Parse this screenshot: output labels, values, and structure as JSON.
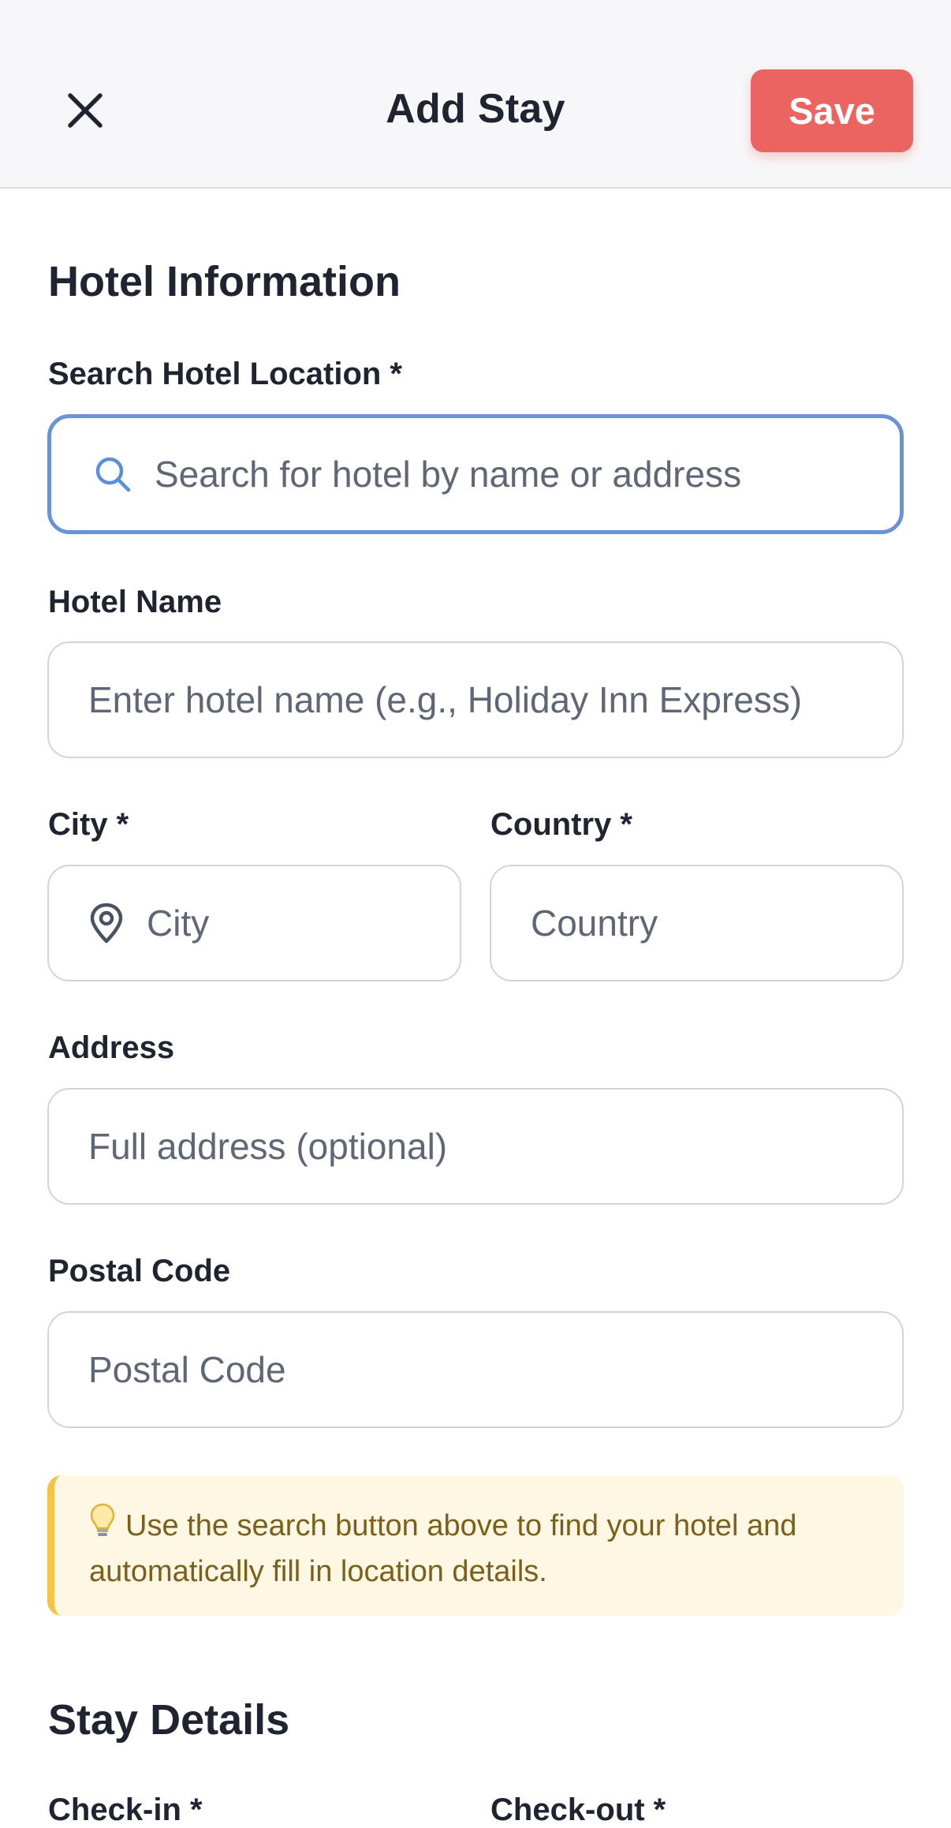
{
  "header": {
    "title": "Add Stay",
    "save_label": "Save",
    "close_icon": "close-icon"
  },
  "hotel_section": {
    "title": "Hotel Information",
    "search": {
      "label": "Search Hotel Location *",
      "placeholder": "Search for hotel by name or address",
      "value": "",
      "icon": "search-icon"
    },
    "hotel_name": {
      "label": "Hotel Name",
      "placeholder": "Enter hotel name (e.g., Holiday Inn Express)",
      "value": ""
    },
    "city": {
      "label": "City *",
      "placeholder": "City",
      "value": "",
      "icon": "location-pin-icon"
    },
    "country": {
      "label": "Country *",
      "placeholder": "Country",
      "value": ""
    },
    "address": {
      "label": "Address",
      "placeholder": "Full address (optional)",
      "value": ""
    },
    "postal_code": {
      "label": "Postal Code",
      "placeholder": "Postal Code",
      "value": ""
    },
    "tip": {
      "icon": "lightbulb-icon",
      "text": "Use the search button above to find your hotel and automatically fill in location details."
    }
  },
  "stay_section": {
    "title": "Stay Details",
    "checkin_label": "Check-in *",
    "checkout_label": "Check-out *"
  },
  "colors": {
    "accent": "#ec6461",
    "focus_border": "#6a93d6",
    "tip_background": "#fdf7e4",
    "tip_border": "#f2c544",
    "tip_text": "#7c5f1a"
  }
}
